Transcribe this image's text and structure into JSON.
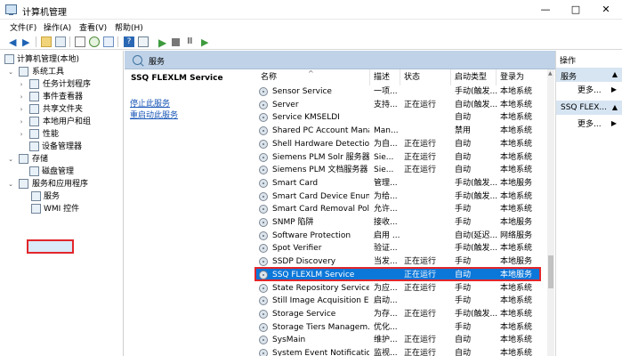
{
  "window": {
    "title": "计算机管理",
    "minimize": "—",
    "maximize": "□",
    "close": "✕"
  },
  "menu": [
    "文件(F)",
    "操作(A)",
    "查看(V)",
    "帮助(H)"
  ],
  "toolbar": {
    "icons": [
      "back-icon",
      "forward-icon",
      "folder-icon",
      "grid-icon",
      "document-icon",
      "refresh-icon",
      "export-icon",
      "help-icon",
      "list-icon",
      "play-icon",
      "stop-icon",
      "pause-icon",
      "resume-icon"
    ]
  },
  "tree": [
    {
      "label": "计算机管理(本地)",
      "level": 0
    },
    {
      "label": "系统工具",
      "level": 1
    },
    {
      "label": "任务计划程序",
      "level": 2
    },
    {
      "label": "事件查看器",
      "level": 2
    },
    {
      "label": "共享文件夹",
      "level": 2
    },
    {
      "label": "本地用户和组",
      "level": 2
    },
    {
      "label": "性能",
      "level": 2
    },
    {
      "label": "设备管理器",
      "level": 2
    },
    {
      "label": "存储",
      "level": 1
    },
    {
      "label": "磁盘管理",
      "level": 2
    },
    {
      "label": "服务和应用程序",
      "level": 1
    },
    {
      "label": "服务",
      "level": 2
    },
    {
      "label": "WMI 控件",
      "level": 2
    }
  ],
  "center": {
    "header": "服务",
    "selected_service": "SSQ FLEXLM Service",
    "stop_link": "停止此服务",
    "restart_link": "重启动此服务"
  },
  "columns": [
    "名称",
    "描述",
    "状态",
    "启动类型",
    "登录为"
  ],
  "services": [
    {
      "name": "Sensor Service",
      "desc": "一项...",
      "status": "",
      "startup": "手动(触发...",
      "logon": "本地系统"
    },
    {
      "name": "Server",
      "desc": "支持...",
      "status": "正在运行",
      "startup": "自动(触发...",
      "logon": "本地系统"
    },
    {
      "name": "Service KMSELDI",
      "desc": "",
      "status": "",
      "startup": "自动",
      "logon": "本地系统"
    },
    {
      "name": "Shared PC Account Mana...",
      "desc": "Man...",
      "status": "",
      "startup": "禁用",
      "logon": "本地系统"
    },
    {
      "name": "Shell Hardware Detection",
      "desc": "为自...",
      "status": "正在运行",
      "startup": "自动",
      "logon": "本地系统"
    },
    {
      "name": "Siemens PLM Solr 服务器",
      "desc": "Sie...",
      "status": "正在运行",
      "startup": "自动",
      "logon": "本地系统"
    },
    {
      "name": "Siemens PLM 文档服务器",
      "desc": "Sie...",
      "status": "正在运行",
      "startup": "自动",
      "logon": "本地系统"
    },
    {
      "name": "Smart Card",
      "desc": "管理...",
      "status": "",
      "startup": "手动(触发...",
      "logon": "本地服务"
    },
    {
      "name": "Smart Card Device Enum...",
      "desc": "为给...",
      "status": "",
      "startup": "手动(触发...",
      "logon": "本地系统"
    },
    {
      "name": "Smart Card Removal Poli...",
      "desc": "允许...",
      "status": "",
      "startup": "手动",
      "logon": "本地系统"
    },
    {
      "name": "SNMP 陷阱",
      "desc": "接收...",
      "status": "",
      "startup": "手动",
      "logon": "本地服务"
    },
    {
      "name": "Software Protection",
      "desc": "启用 ...",
      "status": "",
      "startup": "自动(延迟...",
      "logon": "网络服务"
    },
    {
      "name": "Spot Verifier",
      "desc": "验证...",
      "status": "",
      "startup": "手动(触发...",
      "logon": "本地系统"
    },
    {
      "name": "SSDP Discovery",
      "desc": "当发...",
      "status": "正在运行",
      "startup": "手动",
      "logon": "本地服务"
    },
    {
      "name": "SSQ FLEXLM Service",
      "desc": "",
      "status": "正在运行",
      "startup": "自动",
      "logon": "本地服务"
    },
    {
      "name": "State Repository Service",
      "desc": "为应...",
      "status": "正在运行",
      "startup": "手动",
      "logon": "本地系统"
    },
    {
      "name": "Still Image Acquisition Ev...",
      "desc": "启动...",
      "status": "",
      "startup": "手动",
      "logon": "本地系统"
    },
    {
      "name": "Storage Service",
      "desc": "为存...",
      "status": "正在运行",
      "startup": "手动(触发...",
      "logon": "本地系统"
    },
    {
      "name": "Storage Tiers Managem...",
      "desc": "优化...",
      "status": "",
      "startup": "手动",
      "logon": "本地系统"
    },
    {
      "name": "SysMain",
      "desc": "维护...",
      "status": "正在运行",
      "startup": "自动",
      "logon": "本地系统"
    },
    {
      "name": "System Event Notification...",
      "desc": "监视...",
      "status": "正在运行",
      "startup": "自动",
      "logon": "本地系统"
    }
  ],
  "actions": {
    "title": "操作",
    "section1": "服务",
    "more1": "更多...",
    "section2": "SSQ FLEX...",
    "more2": "更多..."
  },
  "colors": {
    "selection": "#0a77d9",
    "annotation_red": "#e2262b",
    "header_blue": "#bfd2e8",
    "link": "#1957b7"
  }
}
